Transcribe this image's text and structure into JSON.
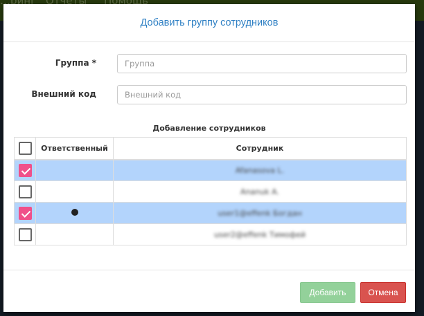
{
  "background_nav": [
    "…ринг",
    "Отчеты",
    "Помощь"
  ],
  "modal": {
    "title": "Добавить группу сотрудников",
    "fields": [
      {
        "label": "Группа *",
        "value": "",
        "placeholder": "Группа"
      },
      {
        "label": "Внешний код",
        "value": "",
        "placeholder": "Внешний код"
      }
    ],
    "section_title": "Добавление сотрудников",
    "table": {
      "headers": [
        "",
        "Ответственный",
        "Сотрудник"
      ],
      "rows": [
        {
          "checked": true,
          "responsible": false,
          "employee": "Afanasova L."
        },
        {
          "checked": false,
          "responsible": false,
          "employee": "Ananuk A."
        },
        {
          "checked": true,
          "responsible": true,
          "employee": "user1@effenk Богдан"
        },
        {
          "checked": false,
          "responsible": false,
          "employee": "user2@effenk Тимофей"
        }
      ]
    },
    "buttons": {
      "add": "Добавить",
      "cancel": "Отмена"
    },
    "colors": {
      "title": "#2f80c4",
      "checkbox_checked": "#f0508a",
      "selected_row": "#b3d4fc",
      "add_button": "#93d19a",
      "cancel_button": "#d9534f"
    }
  }
}
